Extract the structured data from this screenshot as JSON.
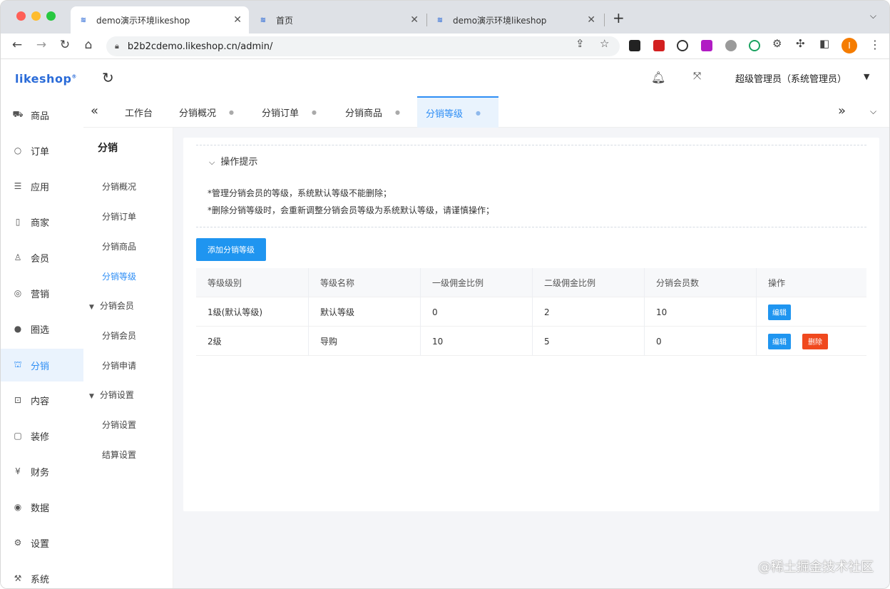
{
  "browser": {
    "tabs": [
      {
        "title": "demo演示环境likeshop",
        "icon": "likeshop-favicon",
        "close": "✕"
      },
      {
        "title": "首页",
        "icon": "likeshop-favicon",
        "close": "✕"
      },
      {
        "title": "demo演示环境likeshop",
        "icon": "likeshop-favicon",
        "close": "✕"
      }
    ],
    "new_tab": "+",
    "tab_menu": "⌵",
    "url": "b2b2cdemo.likeshop.cn/admin/",
    "profile_initial": "I"
  },
  "app": {
    "logo": "likeshop",
    "logo_mark": "®",
    "sidebar": [
      {
        "label": "商品",
        "icon": "cart-icon"
      },
      {
        "label": "订单",
        "icon": "order-icon"
      },
      {
        "label": "应用",
        "icon": "apps-icon"
      },
      {
        "label": "商家",
        "icon": "store-icon"
      },
      {
        "label": "会员",
        "icon": "user-icon"
      },
      {
        "label": "营销",
        "icon": "marketing-icon"
      },
      {
        "label": "圈选",
        "icon": "circle-icon"
      },
      {
        "label": "分销",
        "icon": "distribution-icon",
        "active": true
      },
      {
        "label": "内容",
        "icon": "content-icon"
      },
      {
        "label": "装修",
        "icon": "decoration-icon"
      },
      {
        "label": "财务",
        "icon": "finance-icon"
      },
      {
        "label": "数据",
        "icon": "data-icon"
      },
      {
        "label": "设置",
        "icon": "settings-icon"
      },
      {
        "label": "系统",
        "icon": "system-icon"
      }
    ],
    "user": "超级管理员（系统管理员）",
    "page_tabs": [
      "工作台",
      "分销概况",
      "分销订单",
      "分销商品",
      "分销等级"
    ],
    "active_page_tab": "分销等级",
    "submenu": {
      "title": "分销",
      "items": [
        "分销概况",
        "分销订单",
        "分销商品",
        "分销等级"
      ],
      "active": "分销等级",
      "groups": [
        {
          "label": "分销会员",
          "items": [
            "分销会员",
            "分销申请"
          ]
        },
        {
          "label": "分销设置",
          "items": [
            "分销设置",
            "结算设置"
          ]
        }
      ]
    },
    "tips": {
      "title": "操作提示",
      "lines": [
        "*管理分销会员的等级，系统默认等级不能删除；",
        "*删除分销等级时，会重新调整分销会员等级为系统默认等级，请谨慎操作；"
      ]
    },
    "add_button": "添加分销等级",
    "table": {
      "headers": [
        "等级级别",
        "等级名称",
        "一级佣金比例",
        "二级佣金比例",
        "分销会员数",
        "操作"
      ],
      "rows": [
        {
          "level": "1级(默认等级)",
          "name": "默认等级",
          "first": "0",
          "second": "2",
          "members": "10",
          "edit": "编辑",
          "delete": null
        },
        {
          "level": "2级",
          "name": "导购",
          "first": "10",
          "second": "5",
          "members": "0",
          "edit": "编辑",
          "delete": "删除"
        }
      ]
    },
    "watermark": "@稀土掘金技术社区"
  },
  "colors": {
    "accent": "#2e8ef5",
    "primary_button": "#1f95f0",
    "danger": "#f0491e"
  }
}
